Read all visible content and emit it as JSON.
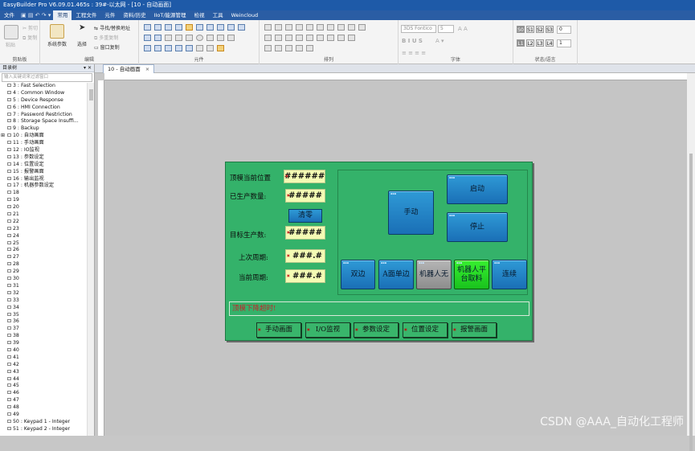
{
  "window": {
    "title": "EasyBuilder Pro V6.09.01.465s : 39#-以太网 - [10 - 自动画面]"
  },
  "menu": {
    "items": [
      "文件",
      "常用",
      "工程文件",
      "元件",
      "资料/历史",
      "IIoT/能源管理",
      "检视",
      "工具",
      "Weincloud"
    ],
    "active_index": 1
  },
  "ribbon": {
    "clipboard": {
      "paste": "粘贴",
      "cut": "剪切",
      "copy": "复制",
      "label": "剪贴板"
    },
    "edit": {
      "sys_params": "系统参数",
      "select": "选择",
      "find_replace": "寻找/替换地址",
      "multi_copy": "多重复制",
      "window_copy": "窗口复制",
      "label": "编辑"
    },
    "elements": {
      "label": "元件"
    },
    "arrange": {
      "label": "排列"
    },
    "font": {
      "font_name": "3DS Fontico",
      "font_size": "5",
      "label": "字体"
    },
    "status": {
      "levels_row1": [
        "S0",
        "S1",
        "S2",
        "S3"
      ],
      "levels_row2": [
        "L1",
        "L2",
        "L3",
        "L4"
      ],
      "value1": "0",
      "value2": "1",
      "label": "状态/语言"
    }
  },
  "sidebar": {
    "title": "目录树",
    "search_placeholder": "输入关键词来过滤窗口",
    "items": [
      "3 : Fast Selection",
      "4 : Common Window",
      "5 : Device Response",
      "6 : HMI Connection",
      "7 : Password Restriction",
      "8 : Storage Space Insuffi...",
      "9 : Backup",
      "10 : 自动画面",
      "11 : 手动画面",
      "12 : IO监视",
      "13 : 参数设定",
      "14 : 位置设定",
      "15 : 报警画面",
      "16 : 输出监视",
      "17 : 机器参数设定",
      "18",
      "19",
      "20",
      "21",
      "22",
      "23",
      "24",
      "25",
      "26",
      "27",
      "28",
      "29",
      "30",
      "31",
      "32",
      "33",
      "34",
      "35",
      "36",
      "37",
      "38",
      "39",
      "40",
      "41",
      "42",
      "43",
      "44",
      "45",
      "46",
      "47",
      "48",
      "49",
      "50 : Keypad 1 - Integer",
      "51 : Keypad 2 - Integer"
    ]
  },
  "tab": {
    "label": "10 - 自动画面",
    "close": "×"
  },
  "hmi": {
    "labels": {
      "mold_pos": "顶模当前位置",
      "produced": "已生产数量:",
      "target": "目标生产数:",
      "last_cycle": "上次周期:",
      "current_cycle": "当前周期:"
    },
    "values": {
      "mold_pos": "######",
      "produced": "#####",
      "target": "#####",
      "last_cycle": "###.#",
      "current_cycle": "###.#"
    },
    "clear_btn": "清零",
    "buttons": {
      "manual": "手动",
      "start": "启动",
      "stop": "停止",
      "dual": "双边",
      "single_a": "A面单边",
      "robot_none": "机器人无",
      "robot_platform": "机器人平台取料",
      "continuous": "连续"
    },
    "message": "顶模下降超时!",
    "nav": [
      "手动画面",
      "I/O监视",
      "参数设定",
      "位置设定",
      "报警画面"
    ]
  },
  "watermark": "CSDN @AAA_自动化工程师"
}
